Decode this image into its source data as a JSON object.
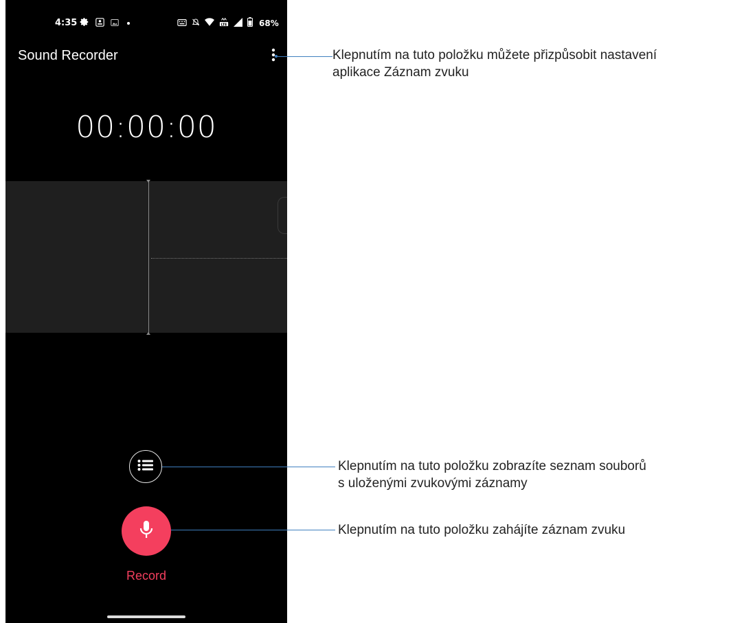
{
  "status_bar": {
    "time": "4:35",
    "battery_percent": "68%",
    "left_icons": [
      "settings-icon",
      "screen-record-icon",
      "image-icon",
      "notification-dot-icon"
    ],
    "right_icons": [
      "keyboard-icon",
      "mute-icon",
      "wifi-icon",
      "lte-icon",
      "signal-icon",
      "battery-icon"
    ]
  },
  "app_bar": {
    "title": "Sound Recorder",
    "overflow_icon": "more-vert-icon"
  },
  "timer": "00:00:00",
  "controls": {
    "list_icon": "list-icon",
    "record_icon": "mic-icon",
    "record_label": "Record"
  },
  "colors": {
    "accent": "#f43f5e",
    "background": "#000000",
    "waveform_bg": "#1f1f1f",
    "callout_line": "#3f7fbf"
  },
  "callouts": [
    {
      "line1": "Klepnutím na tuto položku můžete přizpůsobit nastavení",
      "line2": "aplikace Záznam zvuku"
    },
    {
      "line1": "Klepnutím na tuto položku zobrazíte seznam souborů",
      "line2": "s uloženými zvukovými záznamy"
    },
    {
      "line1": "Klepnutím na tuto položku zahájíte záznam zvuku"
    }
  ]
}
